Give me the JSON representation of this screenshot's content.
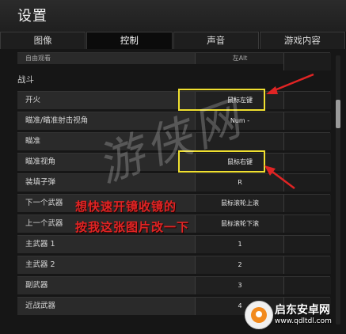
{
  "window": {
    "title": "设置"
  },
  "tabs": [
    {
      "label": "图像"
    },
    {
      "label": "控制"
    },
    {
      "label": "声音"
    },
    {
      "label": "游戏内容"
    }
  ],
  "top_partial_row": {
    "label": "自由观看",
    "value": "左Alt"
  },
  "section": {
    "title": "战斗"
  },
  "rows": [
    {
      "label": "开火",
      "value": "鼠标左键"
    },
    {
      "label": "瞄准/瞄准射击视角",
      "value": "Num -"
    },
    {
      "label": "瞄准",
      "value": ""
    },
    {
      "label": "瞄准视角",
      "value": "鼠标右键"
    },
    {
      "label": "装填子弹",
      "value": "R"
    },
    {
      "label": "下一个武器",
      "value": "鼠标滚轮上滚"
    },
    {
      "label": "上一个武器",
      "value": "鼠标滚轮下滚"
    },
    {
      "label": "主武器 1",
      "value": "1"
    },
    {
      "label": "主武器 2",
      "value": "2"
    },
    {
      "label": "副武器",
      "value": "3"
    },
    {
      "label": "近战武器",
      "value": "4"
    }
  ],
  "annotation": {
    "line1": "想快速开镜收镜的",
    "line2": "按我这张图片改一下",
    "color": "#e02424"
  },
  "watermark": {
    "text": "游侠网"
  },
  "logo": {
    "name": "启东安卓网",
    "url": "www.qdltdl.com"
  },
  "colors": {
    "highlight": "#f0e030",
    "arrow": "#e02424"
  }
}
